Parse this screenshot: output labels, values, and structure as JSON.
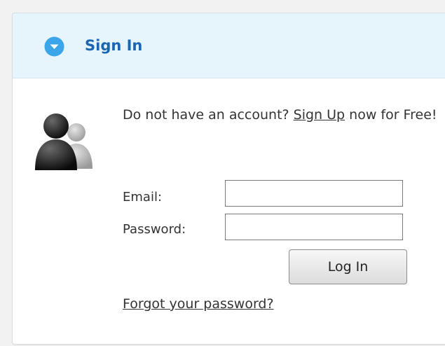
{
  "header": {
    "title": "Sign In",
    "icon": "chevron-down-circle-icon",
    "accent_color": "#1a66b3",
    "icon_color": "#3aa5e8",
    "background_color": "#e6f4fc"
  },
  "avatar": {
    "icon": "users-icon"
  },
  "signup": {
    "prefix": "Do not have an account? ",
    "link_label": "Sign Up",
    "suffix": " now for Free!"
  },
  "form": {
    "email_label": "Email:",
    "email_value": "",
    "password_label": "Password:",
    "password_value": "",
    "login_label": "Log In",
    "forgot_label": "Forgot your password?"
  }
}
